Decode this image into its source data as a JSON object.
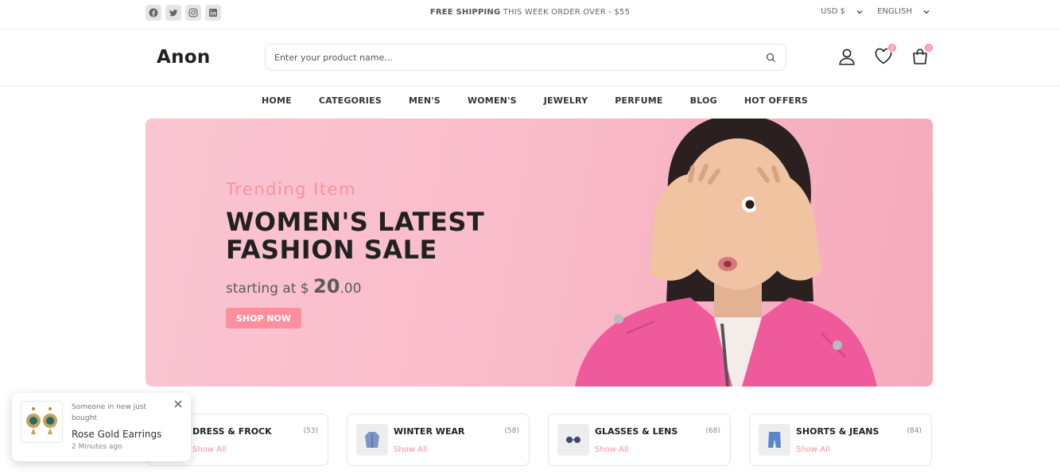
{
  "topbar": {
    "socials": [
      "facebook",
      "twitter",
      "instagram",
      "linkedin"
    ],
    "shipping_bold": "FREE SHIPPING",
    "shipping_rest": " THIS WEEK ORDER OVER - $55",
    "currency": "USD $",
    "language": "ENGLISH"
  },
  "header": {
    "logo": "Anon",
    "search_placeholder": "Enter your product name...",
    "wishlist_count": "0",
    "cart_count": "0"
  },
  "nav": {
    "items": [
      "HOME",
      "CATEGORIES",
      "MEN'S",
      "WOMEN'S",
      "JEWELRY",
      "PERFUME",
      "BLOG",
      "HOT OFFERS"
    ]
  },
  "banner": {
    "subtitle": "Trending Item",
    "title_line1": "WOMEN'S LATEST",
    "title_line2": "FASHION SALE",
    "price_prefix": "starting at $ ",
    "price_main": "20",
    "price_cents": ".00",
    "button": "SHOP NOW"
  },
  "categories": [
    {
      "name": "DRESS & FROCK",
      "count": "(53)",
      "link": "Show All",
      "icon": "dress-icon"
    },
    {
      "name": "WINTER WEAR",
      "count": "(58)",
      "link": "Show All",
      "icon": "coat-icon"
    },
    {
      "name": "GLASSES & LENS",
      "count": "(68)",
      "link": "Show All",
      "icon": "glasses-icon"
    },
    {
      "name": "SHORTS & JEANS",
      "count": "(84)",
      "link": "Show All",
      "icon": "jeans-icon"
    }
  ],
  "toast": {
    "message": "Someone in new just bought",
    "product": "Rose Gold Earrings",
    "time": "2 Minutes ago"
  },
  "colors": {
    "accent": "#ff8f9c",
    "banner_bg": "#f9bccb",
    "text": "#212121"
  }
}
